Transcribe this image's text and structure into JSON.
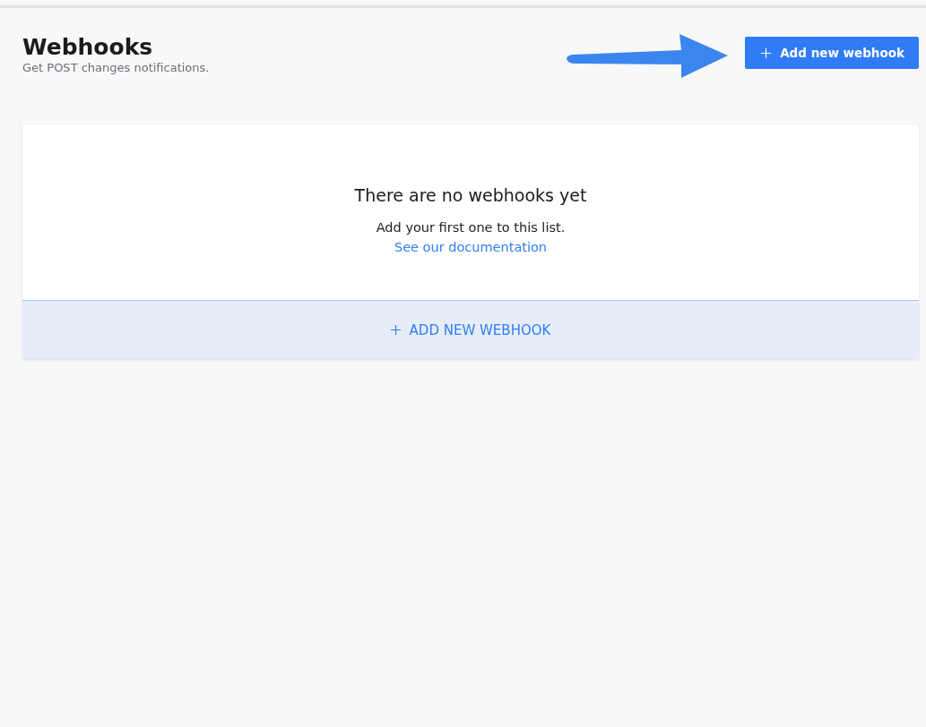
{
  "header": {
    "title": "Webhooks",
    "subtitle": "Get POST changes notifications.",
    "button": "Add new webhook"
  },
  "empty_state": {
    "heading": "There are no webhooks yet",
    "text": "Add your first one to this list.",
    "link": "See our documentation",
    "action": "ADD NEW WEBHOOK"
  }
}
